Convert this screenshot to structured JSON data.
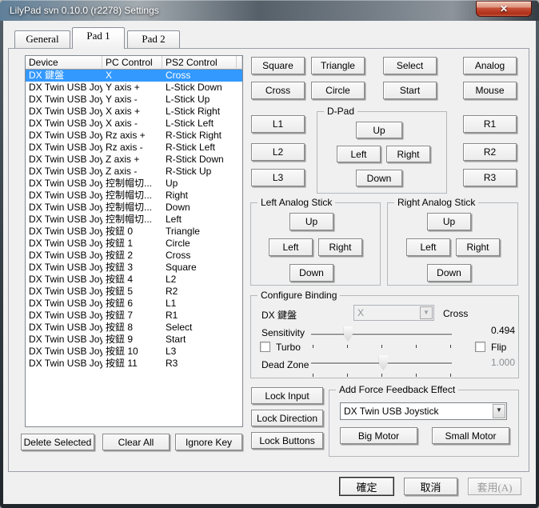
{
  "window": {
    "title": "LilyPad svn 0.10.0 (r2278) Settings",
    "close_glyph": "✕"
  },
  "tabs": [
    {
      "label": "General"
    },
    {
      "label": "Pad 1"
    },
    {
      "label": "Pad 2"
    }
  ],
  "bindings_table": {
    "columns": [
      "Device",
      "PC Control",
      "PS2 Control"
    ],
    "rows": [
      {
        "device": "DX 鍵盤",
        "pc": "X",
        "ps2": "Cross",
        "selected": true
      },
      {
        "device": "DX Twin USB Joy...",
        "pc": "Y axis +",
        "ps2": "L-Stick Down"
      },
      {
        "device": "DX Twin USB Joy...",
        "pc": "Y axis -",
        "ps2": "L-Stick Up"
      },
      {
        "device": "DX Twin USB Joy...",
        "pc": "X axis +",
        "ps2": "L-Stick Right"
      },
      {
        "device": "DX Twin USB Joy...",
        "pc": "X axis -",
        "ps2": "L-Stick Left"
      },
      {
        "device": "DX Twin USB Joy...",
        "pc": "Rz axis +",
        "ps2": "R-Stick Right"
      },
      {
        "device": "DX Twin USB Joy...",
        "pc": "Rz axis -",
        "ps2": "R-Stick Left"
      },
      {
        "device": "DX Twin USB Joy...",
        "pc": "Z axis +",
        "ps2": "R-Stick Down"
      },
      {
        "device": "DX Twin USB Joy...",
        "pc": "Z axis -",
        "ps2": "R-Stick Up"
      },
      {
        "device": "DX Twin USB Joy...",
        "pc": "控制帽切...",
        "ps2": "Up"
      },
      {
        "device": "DX Twin USB Joy...",
        "pc": "控制帽切...",
        "ps2": "Right"
      },
      {
        "device": "DX Twin USB Joy...",
        "pc": "控制帽切...",
        "ps2": "Down"
      },
      {
        "device": "DX Twin USB Joy...",
        "pc": "控制帽切...",
        "ps2": "Left"
      },
      {
        "device": "DX Twin USB Joy...",
        "pc": "按鈕 0",
        "ps2": "Triangle"
      },
      {
        "device": "DX Twin USB Joy...",
        "pc": "按鈕 1",
        "ps2": "Circle"
      },
      {
        "device": "DX Twin USB Joy...",
        "pc": "按鈕 2",
        "ps2": "Cross"
      },
      {
        "device": "DX Twin USB Joy...",
        "pc": "按鈕 3",
        "ps2": "Square"
      },
      {
        "device": "DX Twin USB Joy...",
        "pc": "按鈕 4",
        "ps2": "L2"
      },
      {
        "device": "DX Twin USB Joy...",
        "pc": "按鈕 5",
        "ps2": "R2"
      },
      {
        "device": "DX Twin USB Joy...",
        "pc": "按鈕 6",
        "ps2": "L1"
      },
      {
        "device": "DX Twin USB Joy...",
        "pc": "按鈕 7",
        "ps2": "R1"
      },
      {
        "device": "DX Twin USB Joy...",
        "pc": "按鈕 8",
        "ps2": "Select"
      },
      {
        "device": "DX Twin USB Joy...",
        "pc": "按鈕 9",
        "ps2": "Start"
      },
      {
        "device": "DX Twin USB Joy...",
        "pc": "按鈕 10",
        "ps2": "L3"
      },
      {
        "device": "DX Twin USB Joy...",
        "pc": "按鈕 11",
        "ps2": "R3"
      }
    ]
  },
  "face_buttons": {
    "square": "Square",
    "triangle": "Triangle",
    "select": "Select",
    "analog": "Analog",
    "cross": "Cross",
    "circle": "Circle",
    "start": "Start",
    "mouse": "Mouse"
  },
  "shoulder": {
    "l1": "L1",
    "l2": "L2",
    "l3": "L3",
    "r1": "R1",
    "r2": "R2",
    "r3": "R3"
  },
  "dpad": {
    "title": "D-Pad",
    "up": "Up",
    "left": "Left",
    "right": "Right",
    "down": "Down"
  },
  "left_stick": {
    "title": "Left Analog Stick",
    "up": "Up",
    "left": "Left",
    "right": "Right",
    "down": "Down"
  },
  "right_stick": {
    "title": "Right Analog Stick",
    "up": "Up",
    "left": "Left",
    "right": "Right",
    "down": "Down"
  },
  "configure_binding": {
    "title": "Configure Binding",
    "device_label": "DX 鍵盤",
    "pc_control_value": "X",
    "ps2_control_value": "Cross",
    "sensitivity_label": "Sensitivity",
    "sensitivity_value": "0.494",
    "sensitivity_slider_pct": 26,
    "turbo_label": "Turbo",
    "flip_label": "Flip",
    "dead_zone_label": "Dead Zone",
    "dead_zone_value": "1.000",
    "dead_zone_slider_pct": 51
  },
  "locks": {
    "input": "Lock Input",
    "direction": "Lock Direction",
    "buttons": "Lock Buttons"
  },
  "force_feedback": {
    "title": "Add Force Feedback Effect",
    "device_value": "DX Twin USB Joystick",
    "big_motor": "Big Motor",
    "small_motor": "Small Motor"
  },
  "list_actions": {
    "delete": "Delete Selected",
    "clear": "Clear All",
    "ignore": "Ignore Key"
  },
  "footer": {
    "ok": "確定",
    "cancel": "取消",
    "apply": "套用(A)"
  },
  "colors": {
    "selection": "#3399ff",
    "close_button": "#b5371d",
    "dialog_bg": "#f0f0f0"
  }
}
